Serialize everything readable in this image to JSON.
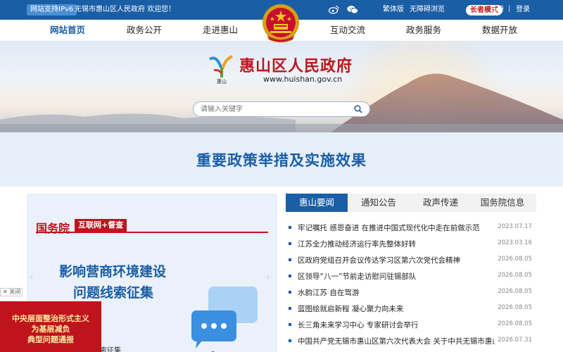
{
  "topbar": {
    "ipv6": "网站支持IPv6",
    "welcome": "无锡市惠山区人民政府 欢迎您！",
    "traditional": "繁体版",
    "accessible": "无障碍浏览",
    "elder": "长者模式",
    "register": "注册",
    "separator": "|",
    "login": "登录",
    "weibo_icon": "weibo-icon",
    "wechat_icon": "wechat-icon"
  },
  "nav": {
    "items": [
      "网站首页",
      "政务公开",
      "走进惠山",
      "互动交流",
      "政务服务",
      "数据开放"
    ]
  },
  "banner": {
    "title": "惠山区人民政府",
    "url": "www.huishan.gov.cn",
    "logo_text": "惠山",
    "search_placeholder": "请输入关键字"
  },
  "policy": {
    "title": "重要政策举措及实施效果"
  },
  "slide": {
    "org": "国务院",
    "tag": "互联网+督查",
    "line1": "影响营商环境建设",
    "line2": "问题线索征集",
    "caption": "线索征集",
    "dots": 7,
    "active_dot": 0
  },
  "float_ad": {
    "close": "关闭",
    "line1": "中央层面整治形式主义",
    "line2": "为基层减负",
    "line3": "典型问题通报"
  },
  "tabs": [
    "惠山要闻",
    "通知公告",
    "政声传递",
    "国务院信息"
  ],
  "news": [
    {
      "title": "牢记嘱托 感恩奋进 在推进中国式现代化中走在前做示范",
      "date": "2023.07.17"
    },
    {
      "title": "江苏全力推动经济运行率先整体好转",
      "date": "2023.03.16"
    },
    {
      "title": "区政府党组召开会议传达学习区第六次党代会精神",
      "date": "2026.08.05"
    },
    {
      "title": "区领导“八一”节前走访慰问驻锡部队",
      "date": "2026.08.05"
    },
    {
      "title": "水韵江苏 自在驾游",
      "date": "2026.08.05"
    },
    {
      "title": "蓝图绘就启新程 凝心聚力向未来",
      "date": "2026.08.05"
    },
    {
      "title": "长三角未来学习中心 专家研讨会举行",
      "date": "2026.08.05"
    },
    {
      "title": "中国共产党无锡市惠山区第六次代表大会 关于中共无锡市惠山...",
      "date": "2026.07.31"
    }
  ],
  "colors": {
    "primary": "#1a5ea6",
    "red": "#c0141c"
  }
}
